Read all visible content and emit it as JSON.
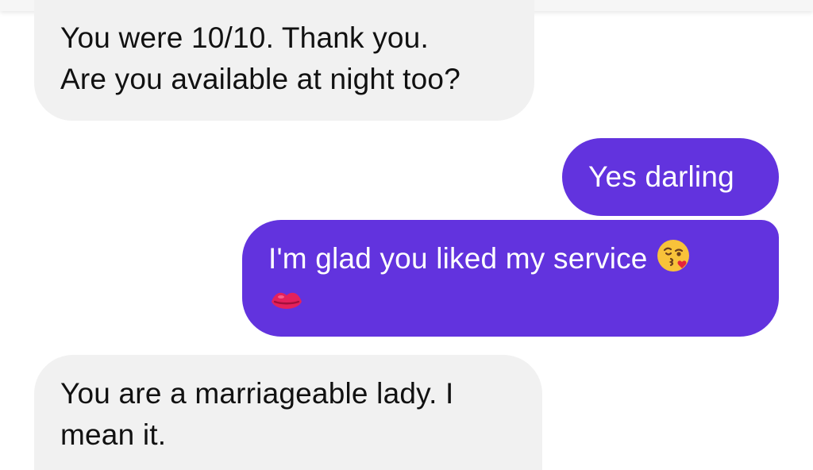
{
  "conversation": {
    "messages": [
      {
        "direction": "incoming",
        "lines": [
          "You were 10/10. Thank you.",
          "Are you available at night too?"
        ]
      },
      {
        "direction": "outgoing",
        "lines": [
          "Yes darling"
        ]
      },
      {
        "direction": "outgoing",
        "lines": [
          "I'm glad you liked my service"
        ],
        "emojis": [
          "face-blowing-kiss-icon",
          "kiss-mark-icon"
        ]
      },
      {
        "direction": "incoming",
        "lines": [
          "You are a marriageable lady. I",
          "mean it."
        ]
      }
    ]
  },
  "colors": {
    "incoming_bubble": "#f1f1f1",
    "outgoing_bubble": "#6233de",
    "incoming_text": "#111111",
    "outgoing_text": "#ffffff"
  }
}
